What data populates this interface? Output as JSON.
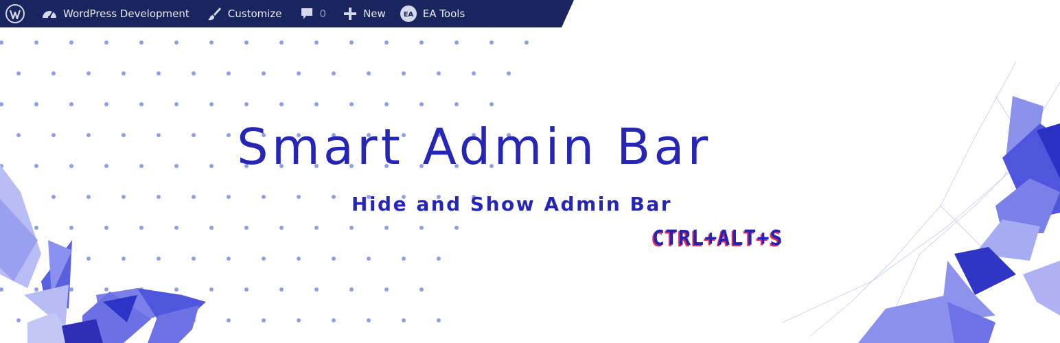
{
  "admin_bar": {
    "items": [
      {
        "icon": "wordpress-logo-icon",
        "label": ""
      },
      {
        "icon": "dashboard-icon",
        "label": "WordPress Development"
      },
      {
        "icon": "brush-icon",
        "label": "Customize"
      },
      {
        "icon": "comment-icon",
        "label": "0"
      },
      {
        "icon": "plus-icon",
        "label": "New"
      },
      {
        "icon": "ea-icon",
        "label": "EA Tools",
        "icon_text": "EA"
      }
    ],
    "background": "#1a2560"
  },
  "banner": {
    "title": "Smart Admin Bar",
    "subtitle": "Hide and Show Admin Bar",
    "shortcut": "CTRL+ALT+S",
    "colors": {
      "primary": "#2525b6",
      "accent": "#e0305a",
      "dots": "#8f9fe6"
    }
  }
}
